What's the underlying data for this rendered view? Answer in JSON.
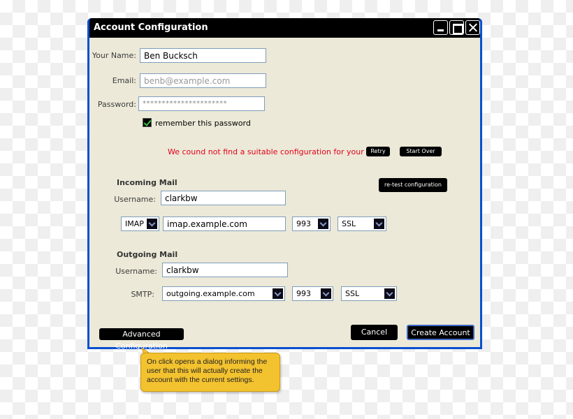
{
  "window": {
    "title": "Account Configuration",
    "controls": {
      "minimize": "minimize",
      "maximize": "maximize",
      "close": "close"
    }
  },
  "account": {
    "name_label": "Your Name:",
    "name_value": "Ben Bucksch",
    "email_label": "Email:",
    "email_placeholder": "benb@example.com",
    "password_label": "Password:",
    "password_value": "**********************",
    "remember_label": "remember this password",
    "remember_checked": true
  },
  "status": {
    "error_message": "We cound not find a suitable configuration for your mail",
    "retry_label": "Retry",
    "start_over_label": "Start Over",
    "retest_label": "re-test configuration"
  },
  "incoming": {
    "heading": "Incoming Mail",
    "username_label": "Username:",
    "username_value": "clarkbw",
    "protocol": "IMAP",
    "server": "imap.example.com",
    "port": "993",
    "security": "SSL"
  },
  "outgoing": {
    "heading": "Outgoing Mail",
    "username_label": "Username:",
    "username_value": "clarkbw",
    "protocol_label": "SMTP:",
    "server": "outgoing.example.com",
    "port": "993",
    "security": "SSL"
  },
  "footer": {
    "advanced_label": "Advanced Configuration",
    "cancel_label": "Cancel",
    "create_label": "Create Account"
  },
  "annotation": {
    "text": "On click opens a dialog informing the user that this will actually create the account with the current settings."
  },
  "colors": {
    "titlebar": "#000000",
    "window_border": "#0a4fd0",
    "dialog_bg": "#ece9d8",
    "error_text": "#e2001a",
    "callout_bg": "#f3c22f"
  }
}
